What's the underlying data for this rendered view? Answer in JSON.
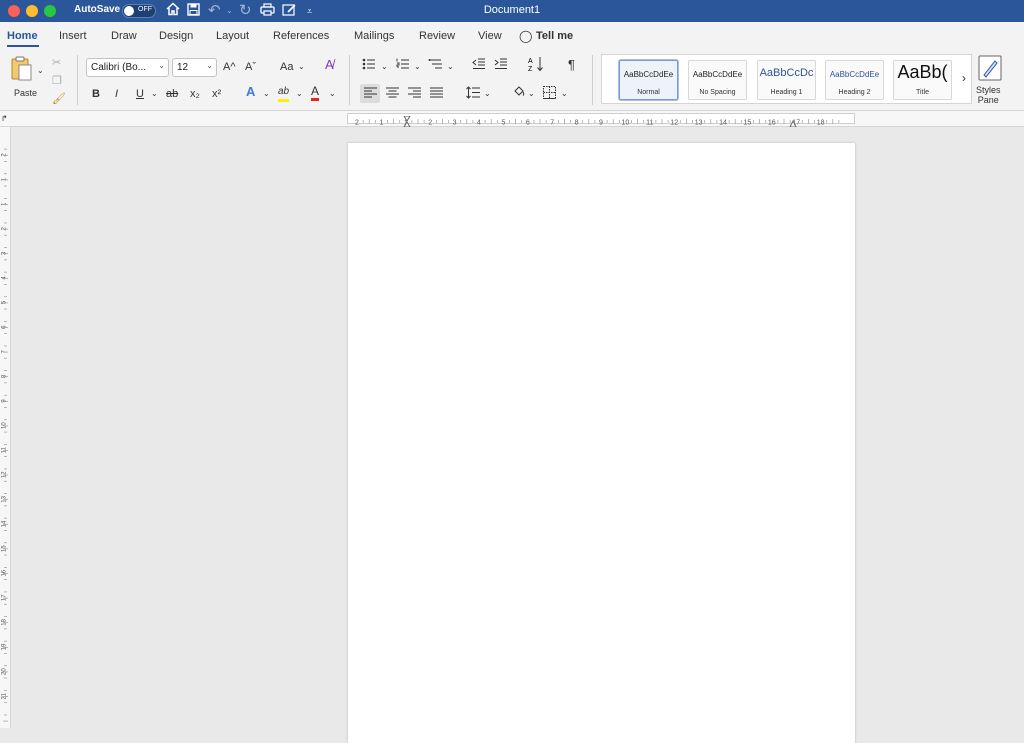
{
  "window": {
    "title": "Document1"
  },
  "titlebar": {
    "autosave_label": "AutoSave",
    "autosave_state": "OFF"
  },
  "tabs": [
    {
      "label": "Home"
    },
    {
      "label": "Insert"
    },
    {
      "label": "Draw"
    },
    {
      "label": "Design"
    },
    {
      "label": "Layout"
    },
    {
      "label": "References"
    },
    {
      "label": "Mailings"
    },
    {
      "label": "Review"
    },
    {
      "label": "View"
    },
    {
      "label": "Tell me"
    }
  ],
  "ribbon": {
    "paste_label": "Paste",
    "font_name": "Calibri (Bo...",
    "font_size": "12",
    "bold": "B",
    "italic": "I",
    "underline": "U",
    "strike": "ab",
    "subscript": "x₂",
    "superscript": "x²",
    "grow_font": "A^",
    "shrink_font": "Aˇ",
    "change_case": "Aa",
    "text_effects": "A",
    "highlight": "ab",
    "font_color": "A",
    "pilcrow": "¶",
    "styles": [
      {
        "sample": "AaBbCcDdEe",
        "name": "Normal"
      },
      {
        "sample": "AaBbCcDdEe",
        "name": "No Spacing"
      },
      {
        "sample": "AaBbCcDc",
        "name": "Heading 1"
      },
      {
        "sample": "AaBbCcDdEe",
        "name": "Heading 2"
      },
      {
        "sample": "AaBb(",
        "name": "Title"
      }
    ],
    "styles_pane_line1": "Styles",
    "styles_pane_line2": "Pane",
    "more_styles": "›"
  },
  "rulers": {
    "horizontal_labels": [
      "2",
      "1",
      "1",
      "2",
      "3",
      "4",
      "5",
      "6",
      "7",
      "8",
      "9",
      "10",
      "11",
      "12",
      "13",
      "14",
      "15",
      "16",
      "17",
      "18"
    ],
    "vertical_labels": [
      "2",
      "1",
      "1",
      "2",
      "3",
      "4",
      "5",
      "6",
      "7",
      "8",
      "9",
      "10",
      "11",
      "12",
      "13",
      "14",
      "15",
      "16",
      "17",
      "18",
      "19",
      "20",
      "21"
    ]
  },
  "colors": {
    "accent": "#2b579a",
    "titlebar": "#2b579a",
    "ribbon_bg": "#f3f3f3",
    "canvas_bg": "#e9e9e9",
    "font_color_bar": "#e8261b",
    "highlight_bar": "#ffef00"
  }
}
